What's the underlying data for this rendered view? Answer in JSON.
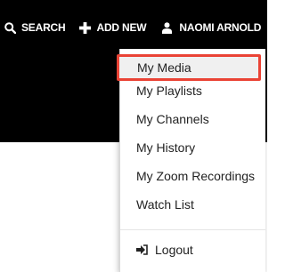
{
  "nav": {
    "search_label": "SEARCH",
    "add_new_label": "ADD NEW",
    "user_name": "NAOMI ARNOLD"
  },
  "menu": {
    "items": [
      {
        "label": "My Media",
        "focused": true
      },
      {
        "label": "My Playlists"
      },
      {
        "label": "My Channels"
      },
      {
        "label": "My History"
      },
      {
        "label": "My Zoom Recordings"
      },
      {
        "label": "Watch List"
      }
    ],
    "logout_label": "Logout"
  },
  "colors": {
    "header_bg": "#000000",
    "focus_outline": "#ea4335"
  }
}
